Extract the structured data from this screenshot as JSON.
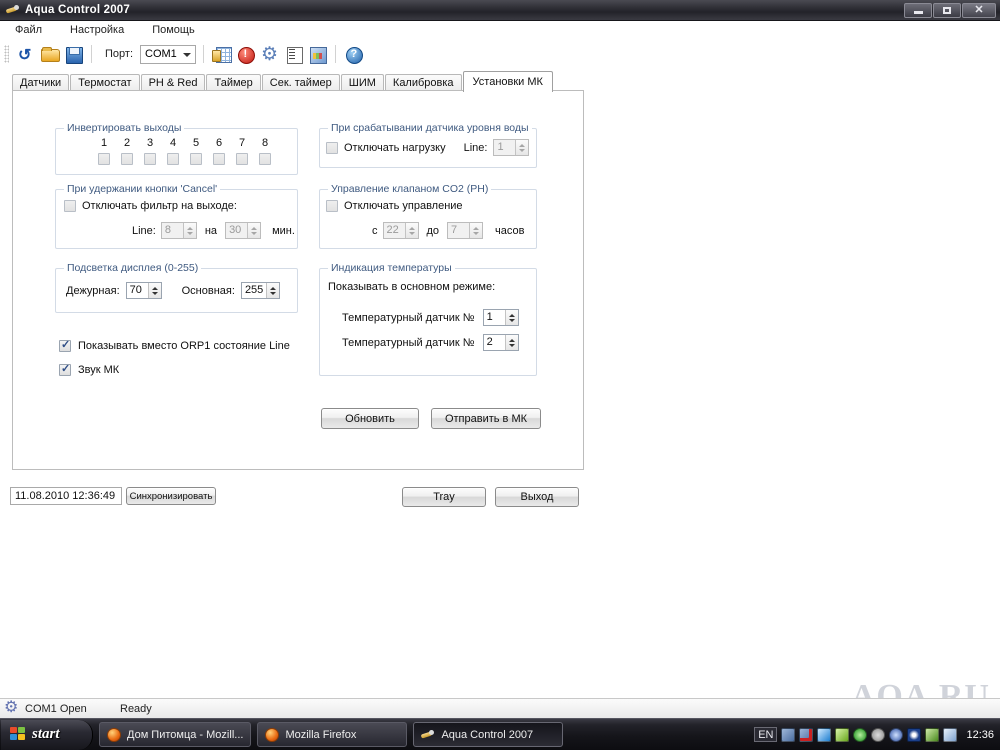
{
  "window": {
    "title": "Aqua Control 2007",
    "icon": "aqua-icon",
    "controls": {
      "minimize": "–",
      "restore": "❐",
      "close": "✕"
    }
  },
  "menu": {
    "items": [
      "Файл",
      "Настройка",
      "Помощь"
    ]
  },
  "toolbar": {
    "port_label": "Порт:",
    "port_value": "COM1",
    "icons": [
      "refresh-icon",
      "open-file-icon",
      "save-icon",
      "table-icon",
      "alert-icon",
      "gear-icon",
      "list-icon",
      "chart-icon",
      "help-icon"
    ]
  },
  "tabs": {
    "items": [
      "Датчики",
      "Термостат",
      "PH & Red",
      "Таймер",
      "Сек. таймер",
      "ШИМ",
      "Калибровка",
      "Установки МК"
    ],
    "active_index": 7
  },
  "groups": {
    "invert_outputs": {
      "legend": "Инвертировать выходы",
      "numbers": [
        "1",
        "2",
        "3",
        "4",
        "5",
        "6",
        "7",
        "8"
      ],
      "checked": [
        false,
        false,
        false,
        false,
        false,
        false,
        false,
        false
      ]
    },
    "cancel_hold": {
      "legend": "При удержании кнопки 'Cancel'",
      "checkbox_label": "Отключать фильтр на выходе:",
      "checkbox_checked": false,
      "line_label": "Line:",
      "line_value": "8",
      "mid_label": "на",
      "minutes_value": "30",
      "minutes_unit": "мин."
    },
    "backlight": {
      "legend": "Подсветка дисплея (0-255)",
      "standby_label": "Дежурная:",
      "standby_value": "70",
      "main_label": "Основная:",
      "main_value": "255"
    },
    "water_level": {
      "legend": "При срабатывании датчика уровня воды",
      "checkbox_label": "Отключать нагрузку",
      "checkbox_checked": false,
      "line_label": "Line:",
      "line_value": "1"
    },
    "co2_valve": {
      "legend": "Управление клапаном CO2 (PH)",
      "checkbox_label": "Отключать управление",
      "checkbox_checked": false,
      "from_label": "с",
      "from_value": "22",
      "to_label": "до",
      "to_value": "7",
      "unit": "часов"
    },
    "temp_indication": {
      "legend": "Индикация температуры",
      "subtitle": "Показывать в основном режиме:",
      "sensor1_label": "Температурный датчик №",
      "sensor1_value": "1",
      "sensor2_label": "Температурный датчик №",
      "sensor2_value": "2"
    }
  },
  "standalone_checkboxes": [
    {
      "label": "Показывать вместо ORP1 состояние Line",
      "checked": true
    },
    {
      "label": "Звук МК",
      "checked": true
    }
  ],
  "action_buttons": {
    "refresh": "Обновить",
    "send": "Отправить в МК"
  },
  "bottom_bar": {
    "datetime": "11.08.2010 12:36:49",
    "sync_button": "Синхронизировать",
    "tray_button": "Tray",
    "exit_button": "Выход"
  },
  "statusbar": {
    "connection": "COM1 Open",
    "state": "Ready"
  },
  "watermark": "AQA.RU",
  "taskbar": {
    "start": "start",
    "items": [
      {
        "label": "Дом Питомца - Mozill...",
        "icon": "firefox-icon",
        "active": false
      },
      {
        "label": "Mozilla Firefox",
        "icon": "firefox-icon",
        "active": false
      },
      {
        "label": "Aqua Control 2007",
        "icon": "aqua-icon",
        "active": true
      }
    ],
    "tray": {
      "language": "EN",
      "clock": "12:36"
    }
  },
  "colors": {
    "group_border": "#d3dbe6",
    "legend_text": "#3f5a80",
    "desktop": "#ffffff",
    "taskbar": "#15151a"
  }
}
